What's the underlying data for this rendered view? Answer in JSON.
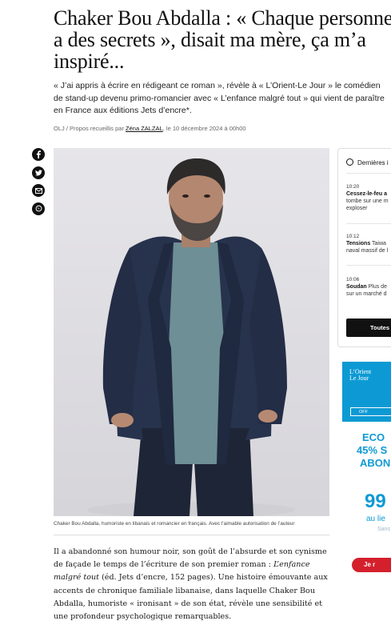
{
  "article": {
    "headline": "Chaker Bou Abdalla : « Chaque personne a des secrets », disait ma mère, ça m’a inspiré...",
    "lead": "« J’ai appris à écrire en rédigeant ce roman », révèle à « L’Orient-Le Jour » le comédien de stand-up devenu primo-romancier avec « L’enfance malgré tout » qui vient de paraître en France aux éditions Jets d’encre*.",
    "byline_prefix": "OLJ / Propos recueillis par ",
    "byline_author": "Zéna ZALZAL",
    "byline_suffix": ", le 10 décembre 2024 à 00h00",
    "caption": "Chaker Bou Abdalla, humoriste en libanais et romancier en français. Avec l’aimable autorisation de l’auteur",
    "body_1": "Il a abandonné son humour noir, son goût de l’absurde et son cynisme de façade le temps de l’écriture de son premier roman : ",
    "body_title": "L’enfance malgré tout",
    "body_2": " (éd. Jets d’encre, 152 pages). Une histoire émouvante aux accents de chronique familiale libanaise, dans laquelle Chaker Bou Abdalla, humoriste « ironisant » de son état, révèle une sensibilité et une profondeur psychologique remarquables."
  },
  "share": {
    "icons": [
      "facebook-icon",
      "twitter-icon",
      "email-icon",
      "whatsapp-icon"
    ]
  },
  "sidebar": {
    "header": "Dernières i",
    "items": [
      {
        "time": "10:20",
        "title": "Cessez-le-feu a",
        "line2": "tombe sur une m",
        "line3": "exploser"
      },
      {
        "time": "10:12",
        "title": "Tensions",
        "title_rest": " Taiwa",
        "line2": "naval massif de l"
      },
      {
        "time": "10:06",
        "title": "Soudan",
        "title_rest": " Plus de",
        "line2": "sur un marché d"
      }
    ],
    "button": "Toutes l"
  },
  "ad": {
    "logo_line1": "L’Orient",
    "logo_line2": "Le Jour",
    "offer": "OFF",
    "line1": "ECO",
    "line2": "45% S",
    "line3": "ABON",
    "price": "99",
    "sub1": "au lie",
    "sub2": "Sans",
    "cta": "Je r"
  },
  "colors": {
    "accent_blue": "#0d9ad4",
    "cta_red": "#d4202c"
  }
}
